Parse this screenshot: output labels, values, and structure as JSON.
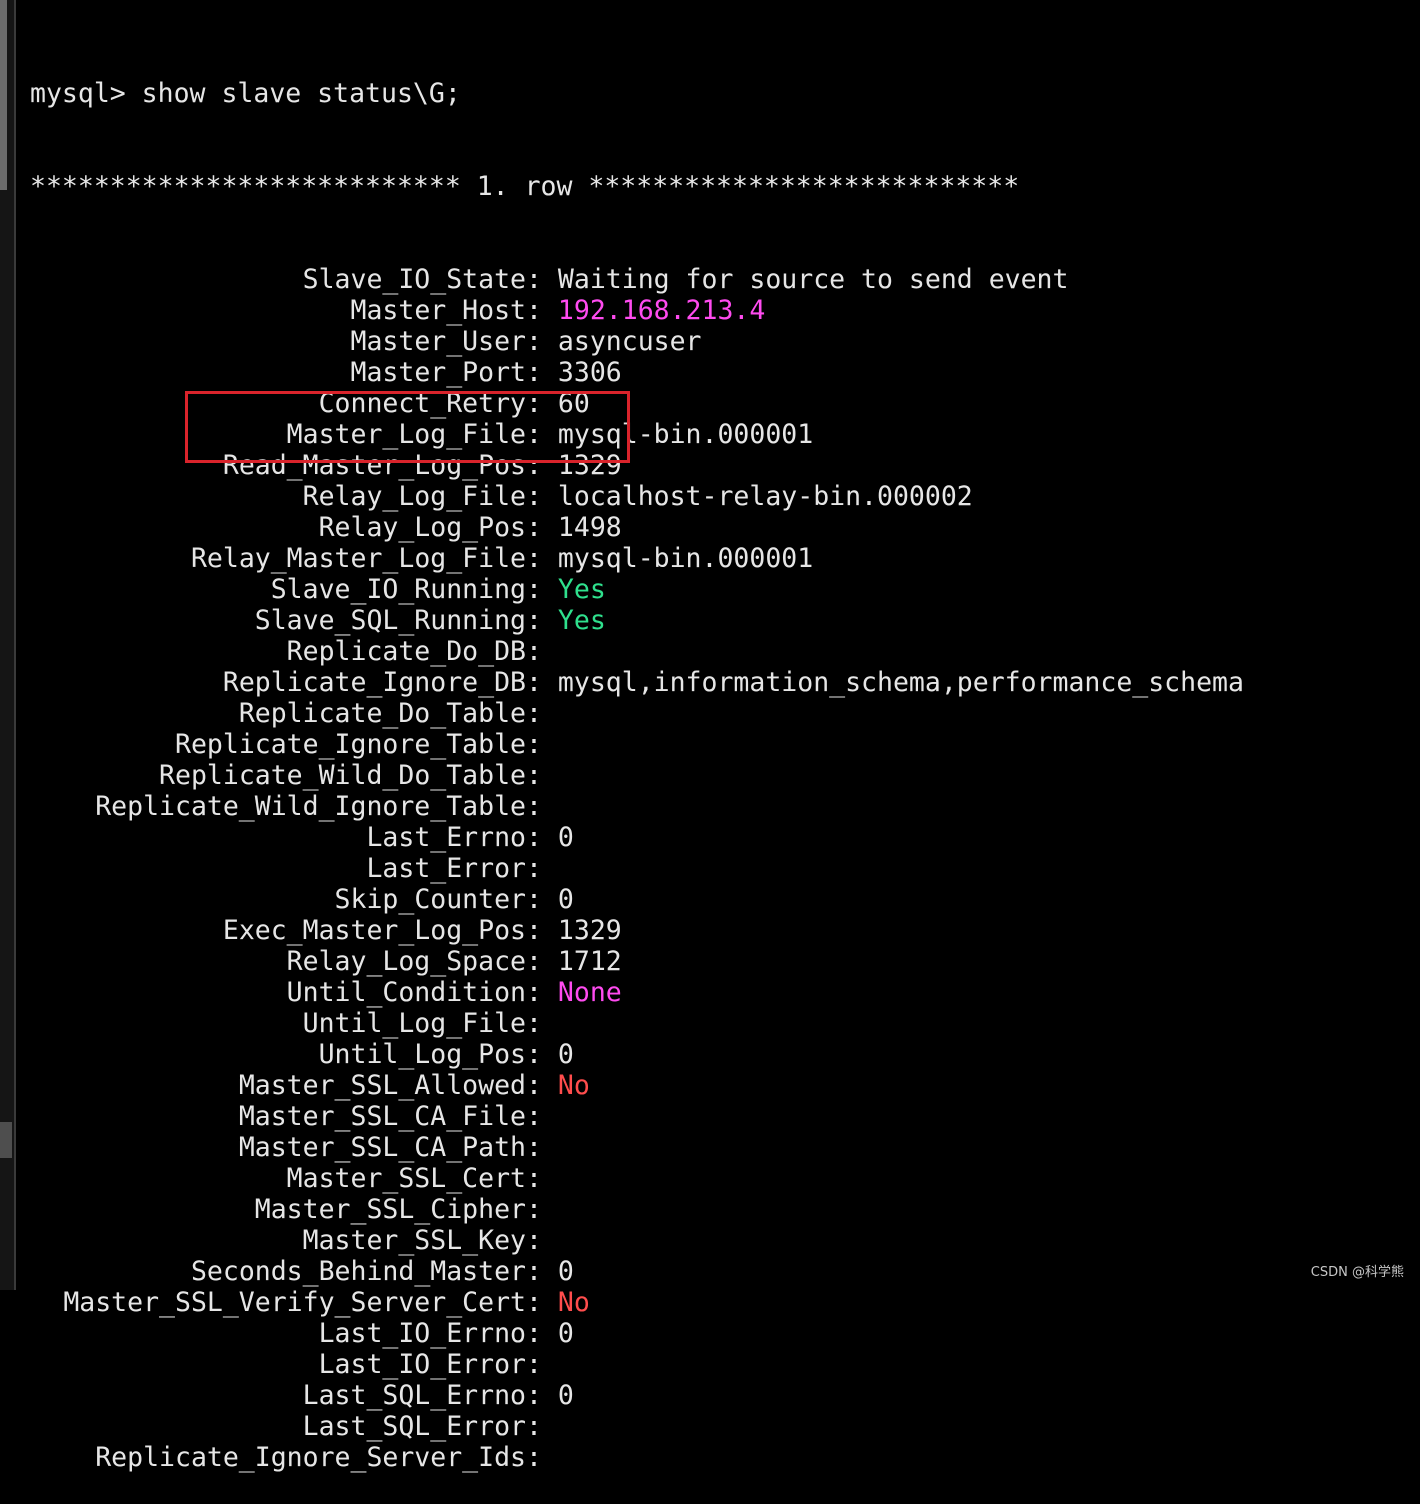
{
  "terminal": {
    "prompt": "mysql> show slave status\\G;",
    "row_header": "*************************** 1. row ***************************",
    "fields": [
      {
        "key": "Slave_IO_State",
        "value": "Waiting for source to send event",
        "color": "default"
      },
      {
        "key": "Master_Host",
        "value": "192.168.213.4",
        "color": "magenta"
      },
      {
        "key": "Master_User",
        "value": "asyncuser",
        "color": "default"
      },
      {
        "key": "Master_Port",
        "value": "3306",
        "color": "default"
      },
      {
        "key": "Connect_Retry",
        "value": "60",
        "color": "default"
      },
      {
        "key": "Master_Log_File",
        "value": "mysql-bin.000001",
        "color": "default"
      },
      {
        "key": "Read_Master_Log_Pos",
        "value": "1329",
        "color": "default"
      },
      {
        "key": "Relay_Log_File",
        "value": "localhost-relay-bin.000002",
        "color": "default"
      },
      {
        "key": "Relay_Log_Pos",
        "value": "1498",
        "color": "default"
      },
      {
        "key": "Relay_Master_Log_File",
        "value": "mysql-bin.000001",
        "color": "default"
      },
      {
        "key": "Slave_IO_Running",
        "value": "Yes",
        "color": "green"
      },
      {
        "key": "Slave_SQL_Running",
        "value": "Yes",
        "color": "green"
      },
      {
        "key": "Replicate_Do_DB",
        "value": "",
        "color": "default"
      },
      {
        "key": "Replicate_Ignore_DB",
        "value": "mysql,information_schema,performance_schema",
        "color": "default"
      },
      {
        "key": "Replicate_Do_Table",
        "value": "",
        "color": "default"
      },
      {
        "key": "Replicate_Ignore_Table",
        "value": "",
        "color": "default"
      },
      {
        "key": "Replicate_Wild_Do_Table",
        "value": "",
        "color": "default"
      },
      {
        "key": "Replicate_Wild_Ignore_Table",
        "value": "",
        "color": "default"
      },
      {
        "key": "Last_Errno",
        "value": "0",
        "color": "default"
      },
      {
        "key": "Last_Error",
        "value": "",
        "color": "default"
      },
      {
        "key": "Skip_Counter",
        "value": "0",
        "color": "default"
      },
      {
        "key": "Exec_Master_Log_Pos",
        "value": "1329",
        "color": "default"
      },
      {
        "key": "Relay_Log_Space",
        "value": "1712",
        "color": "default"
      },
      {
        "key": "Until_Condition",
        "value": "None",
        "color": "magenta"
      },
      {
        "key": "Until_Log_File",
        "value": "",
        "color": "default"
      },
      {
        "key": "Until_Log_Pos",
        "value": "0",
        "color": "default"
      },
      {
        "key": "Master_SSL_Allowed",
        "value": "No",
        "color": "red"
      },
      {
        "key": "Master_SSL_CA_File",
        "value": "",
        "color": "default"
      },
      {
        "key": "Master_SSL_CA_Path",
        "value": "",
        "color": "default"
      },
      {
        "key": "Master_SSL_Cert",
        "value": "",
        "color": "default"
      },
      {
        "key": "Master_SSL_Cipher",
        "value": "",
        "color": "default"
      },
      {
        "key": "Master_SSL_Key",
        "value": "",
        "color": "default"
      },
      {
        "key": "Seconds_Behind_Master",
        "value": "0",
        "color": "default"
      },
      {
        "key": "Master_SSL_Verify_Server_Cert",
        "value": "No",
        "color": "red"
      },
      {
        "key": "Last_IO_Errno",
        "value": "0",
        "color": "default"
      },
      {
        "key": "Last_IO_Error",
        "value": "",
        "color": "default"
      },
      {
        "key": "Last_SQL_Errno",
        "value": "0",
        "color": "default"
      },
      {
        "key": "Last_SQL_Error",
        "value": "",
        "color": "default"
      },
      {
        "key": "Replicate_Ignore_Server_Ids",
        "value": "",
        "color": "default"
      }
    ]
  },
  "colors": {
    "background": "#000000",
    "text": "#e6e6e6",
    "magenta": "#ff4bf0",
    "green": "#2fe08d",
    "red": "#ff4d4d",
    "highlight_box": "#d9232b"
  },
  "watermark": {
    "text": "CSDN @科学熊"
  }
}
